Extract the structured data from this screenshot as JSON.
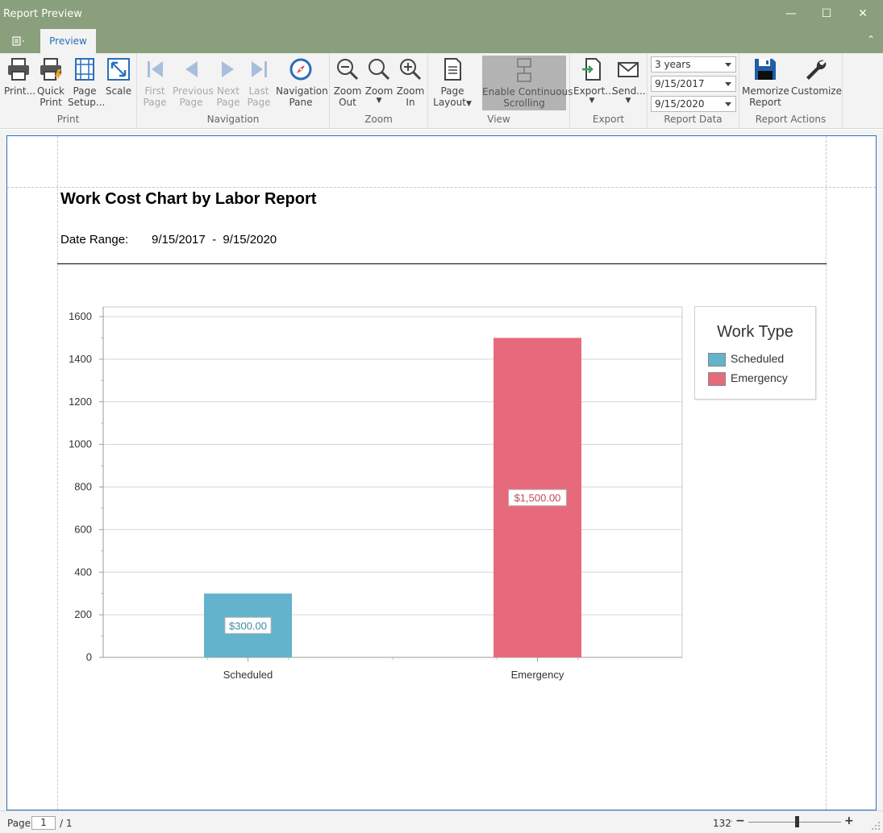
{
  "window": {
    "title": "Report Preview",
    "minimize": "—",
    "maximize": "☐",
    "close": "✕"
  },
  "tabs": {
    "preview": "Preview"
  },
  "ribbon": {
    "print": {
      "print": "Print...",
      "quick_print_1": "Quick",
      "quick_print_2": "Print",
      "page_setup_1": "Page",
      "page_setup_2": "Setup...",
      "scale": "Scale",
      "group": "Print"
    },
    "navigation": {
      "first_1": "First",
      "first_2": "Page",
      "prev_1": "Previous",
      "prev_2": "Page",
      "next_1": "Next",
      "next_2": "Page",
      "last_1": "Last",
      "last_2": "Page",
      "nav_pane_1": "Navigation",
      "nav_pane_2": "Pane",
      "group": "Navigation"
    },
    "zoom": {
      "zoom_out_1": "Zoom",
      "zoom_out_2": "Out",
      "zoom": "Zoom",
      "zoom_in_1": "Zoom",
      "zoom_in_2": "In",
      "group": "Zoom"
    },
    "view": {
      "page_layout_1": "Page",
      "page_layout_2": "Layout",
      "continuous_1": "Enable Continuous",
      "continuous_2": "Scrolling",
      "group": "View"
    },
    "export": {
      "export": "Export...",
      "send": "Send...",
      "group": "Export"
    },
    "report_data": {
      "range": "3 years",
      "start": "9/15/2017",
      "end": "9/15/2020",
      "group": "Report Data"
    },
    "report_actions": {
      "memorize_1": "Memorize",
      "memorize_2": "Report",
      "customize": "Customize",
      "group": "Report Actions"
    }
  },
  "report": {
    "title": "Work Cost Chart by Labor Report",
    "date_label": "Date Range:",
    "date_value": "9/15/2017  -  9/15/2020"
  },
  "chart_data": {
    "type": "bar",
    "categories": [
      "Scheduled",
      "Emergency"
    ],
    "values": [
      300,
      1500
    ],
    "data_labels": [
      "$300.00",
      "$1,500.00"
    ],
    "colors": [
      "#62b3cb",
      "#e66a7c"
    ],
    "ylim": [
      0,
      1600
    ],
    "yticks": [
      0,
      200,
      400,
      600,
      800,
      1000,
      1200,
      1400,
      1600
    ],
    "grid": true,
    "legend": {
      "title": "Work Type",
      "position": "right",
      "entries": [
        "Scheduled",
        "Emergency"
      ]
    },
    "xlabel": "",
    "ylabel": "",
    "title": ""
  },
  "status": {
    "page_label": "Page:",
    "page_current": "1",
    "page_total": "/ 1",
    "zoom": "132%",
    "zoom_minus": "−",
    "zoom_plus": "+"
  },
  "colors": {
    "titlebar": "#8a9f7b",
    "accent": "#2a6ebb",
    "scheduled": "#62b3cb",
    "emergency": "#e66a7c"
  }
}
